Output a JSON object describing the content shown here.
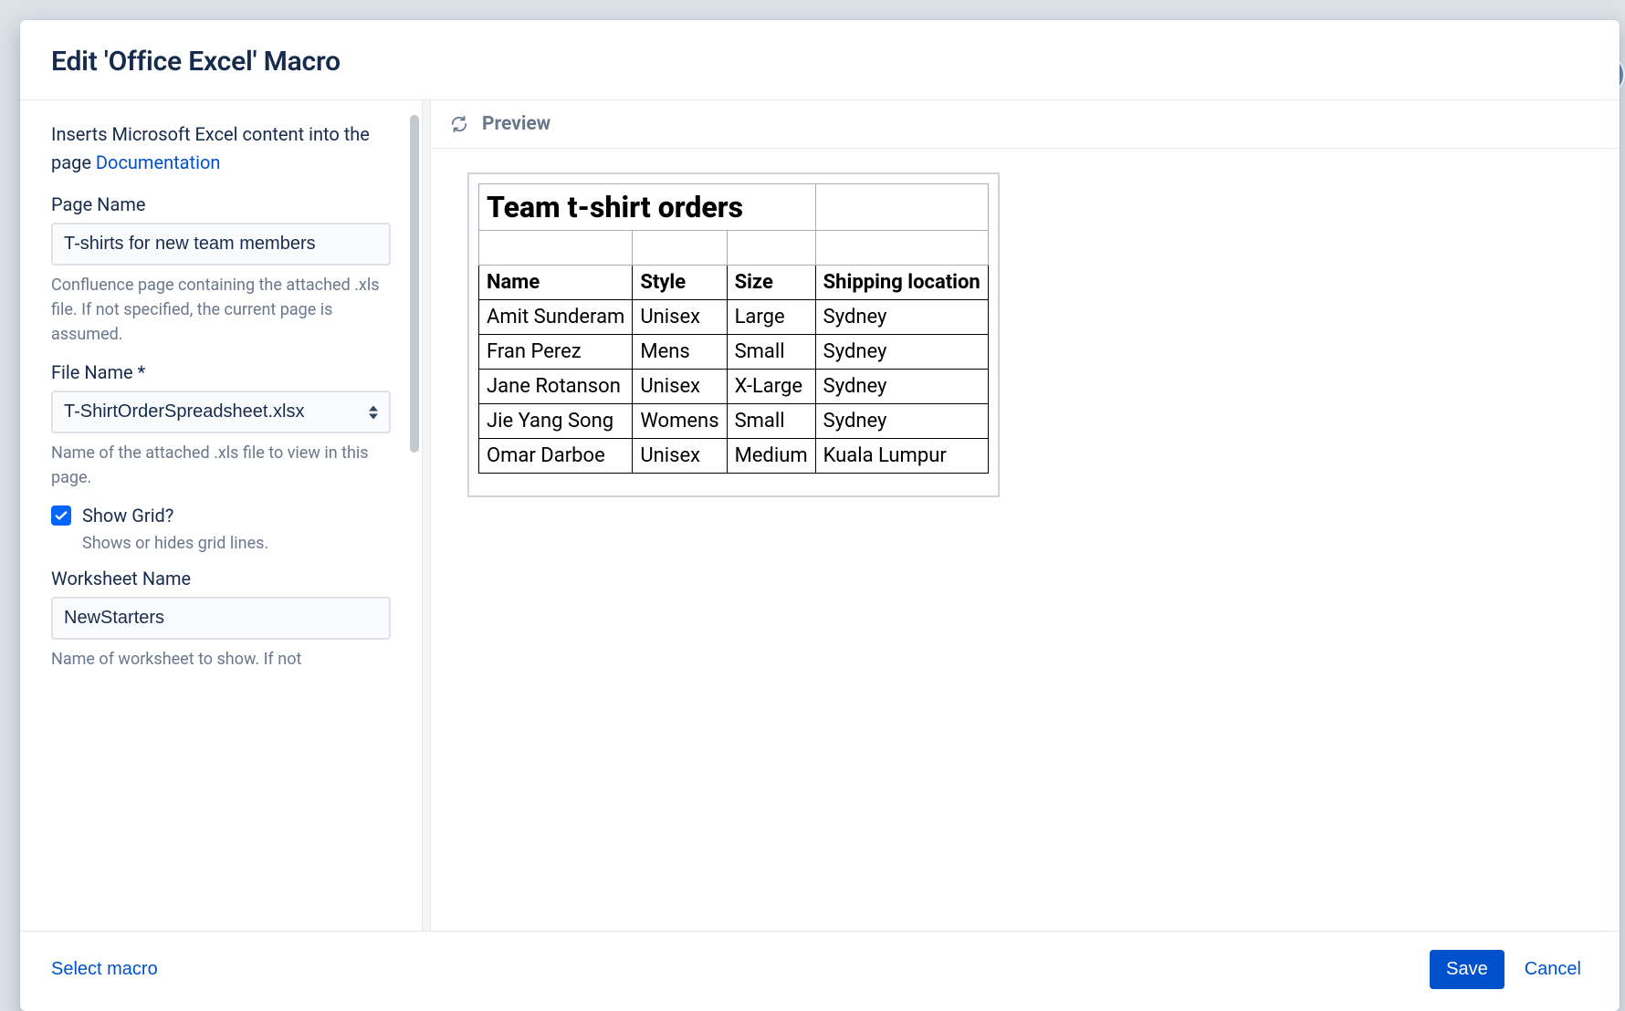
{
  "modal": {
    "title": "Edit 'Office Excel' Macro",
    "description_prefix": "Inserts Microsoft Excel content into the page ",
    "documentation_link": "Documentation"
  },
  "fields": {
    "page_name": {
      "label": "Page Name",
      "value": "T-shirts for new team members",
      "help": "Confluence page containing the attached .xls file. If not specified, the current page is assumed."
    },
    "file_name": {
      "label": "File Name *",
      "value": "T-ShirtOrderSpreadsheet.xlsx",
      "help": "Name of the attached .xls file to view in this page."
    },
    "show_grid": {
      "label": "Show Grid?",
      "checked": true,
      "help": "Shows or hides grid lines."
    },
    "worksheet_name": {
      "label": "Worksheet Name",
      "value": "NewStarters",
      "help": "Name of worksheet to show. If not"
    }
  },
  "preview": {
    "header": "Preview",
    "sheet_title": "Team t-shirt orders",
    "columns": [
      "Name",
      "Style",
      "Size",
      "Shipping location"
    ],
    "rows": [
      [
        "Amit Sunderam",
        "Unisex",
        "Large",
        "Sydney"
      ],
      [
        "Fran Perez",
        "Mens",
        "Small",
        "Sydney"
      ],
      [
        "Jane Rotanson",
        "Unisex",
        "X-Large",
        "Sydney"
      ],
      [
        "Jie Yang Song",
        "Womens",
        "Small",
        "Sydney"
      ],
      [
        "Omar Darboe",
        "Unisex",
        "Medium",
        "Kuala Lumpur"
      ]
    ]
  },
  "footer": {
    "select_macro": "Select macro",
    "save": "Save",
    "cancel": "Cancel"
  }
}
